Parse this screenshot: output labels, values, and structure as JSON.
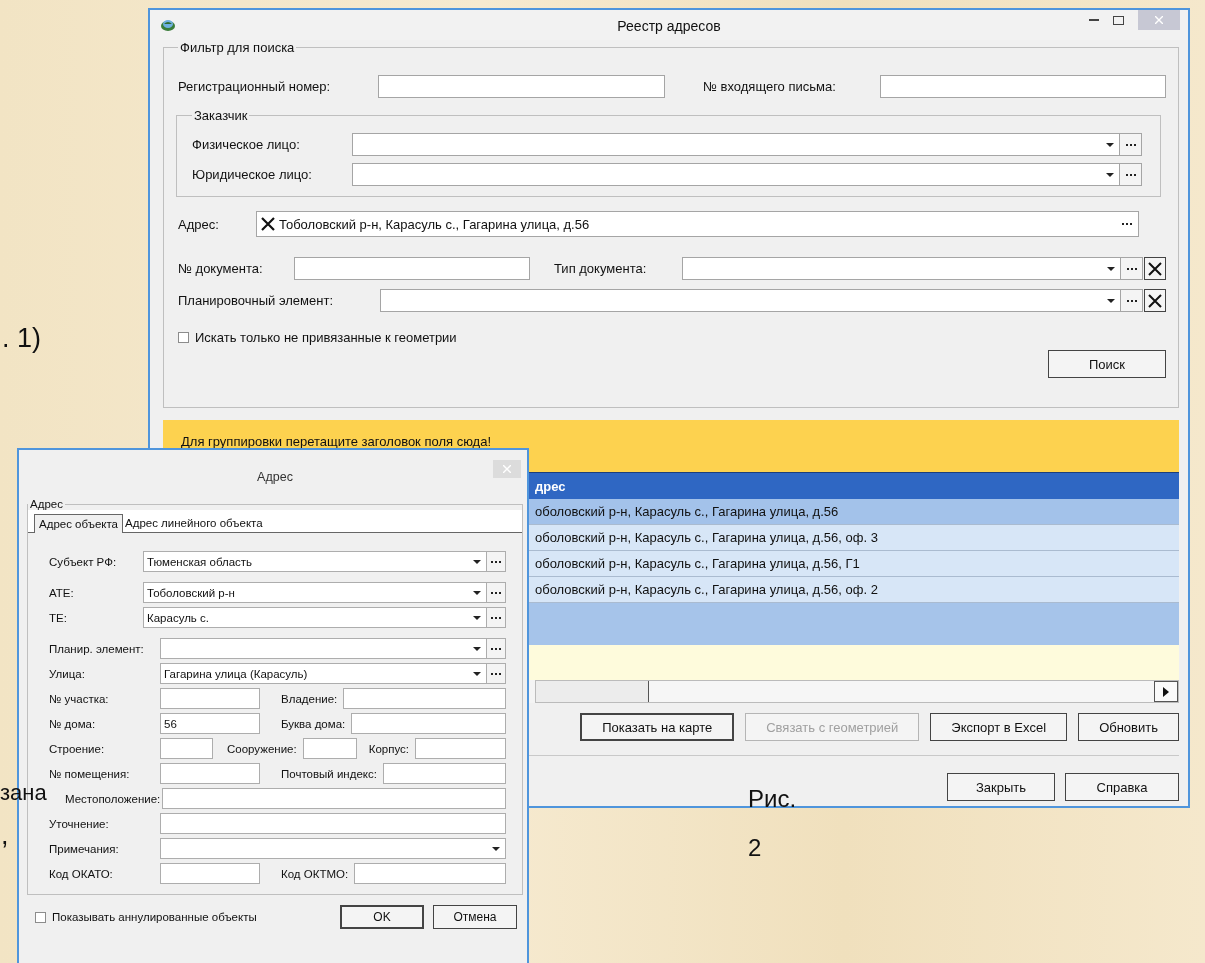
{
  "slide": {
    "texts": [
      {
        "text": ". 1)"
      },
      {
        "text": "зана"
      },
      {
        "text": ","
      },
      {
        "text": "Рис."
      },
      {
        "text": "2"
      }
    ]
  },
  "main_window": {
    "title": "Реестр адресов",
    "filter": {
      "legend": "Фильтр для поиска",
      "reg_number": {
        "label": "Регистрационный номер:"
      },
      "incoming_letter": {
        "label": "№ входящего письма:"
      },
      "customer": {
        "legend": "Заказчик",
        "fields": [
          {
            "label": "Физическое лицо:"
          },
          {
            "label": "Юридическое лицо:"
          }
        ]
      },
      "address": {
        "label": "Адрес:",
        "value": "Тоболовский р-н, Карасуль с., Гагарина улица, д.56"
      },
      "doc_number": {
        "label": "№ документа:"
      },
      "doc_type": {
        "label": "Тип документа:"
      },
      "planning_element": {
        "label": "Планировочный элемент:"
      },
      "unbound_only": {
        "label": "Искать только не привязанные к геометрии",
        "checked": false
      },
      "search_button": "Поиск"
    },
    "grid": {
      "group_hint": "Для группировки перетащите заголовок поля сюда!",
      "columns": [
        "дрес"
      ],
      "rows": [
        {
          "cells": [
            "оболовский р-н, Карасуль с., Гагарина улица, д.56"
          ],
          "selected": true
        },
        {
          "cells": [
            "оболовский р-н, Карасуль с., Гагарина улица, д.56, оф. 3"
          ],
          "selected": false
        },
        {
          "cells": [
            "оболовский р-н, Карасуль с., Гагарина улица, д.56, Г1"
          ],
          "selected": false
        },
        {
          "cells": [
            "оболовский р-н, Карасуль с., Гагарина улица, д.56, оф. 2"
          ],
          "selected": false
        }
      ]
    },
    "buttons": [
      {
        "label": "Показать на карте",
        "disabled": false
      },
      {
        "label": "Связать с геометрией",
        "disabled": true
      },
      {
        "label": "Экспорт в Excel",
        "disabled": false
      },
      {
        "label": "Обновить",
        "disabled": false
      }
    ],
    "footer_buttons": [
      "Закрыть",
      "Справка"
    ]
  },
  "address_dialog": {
    "title": "Адрес",
    "legend": "Адрес",
    "tabs": [
      {
        "label": "Адрес объекта",
        "selected": true
      },
      {
        "label": "Адрес линейного объекта",
        "selected": false
      }
    ],
    "rows": [
      [
        {
          "label": "Субъект РФ:",
          "value": "Тюменская область",
          "kind": "lookup"
        }
      ],
      [
        {
          "label": "АТЕ:",
          "value": "Тоболовский р-н",
          "kind": "lookup"
        }
      ],
      [
        {
          "label": "ТЕ:",
          "value": "Карасуль с.",
          "kind": "lookup"
        }
      ],
      [
        {
          "label": "Планир. элемент:",
          "kind": "lookup"
        }
      ],
      [
        {
          "label": "Улица:",
          "value": "Гагарина улица (Карасуль)",
          "kind": "lookup"
        }
      ],
      [
        {
          "label": "№ участка:",
          "kind": "text"
        },
        {
          "label": "Владение:",
          "kind": "text"
        }
      ],
      [
        {
          "label": "№ дома:",
          "value": "56",
          "kind": "text"
        },
        {
          "label": "Буква дома:",
          "kind": "text"
        }
      ],
      [
        {
          "label": "Строение:",
          "kind": "text"
        },
        {
          "label": "Сооружение:",
          "kind": "text"
        },
        {
          "label": "Корпус:",
          "kind": "text"
        }
      ],
      [
        {
          "label": "№ помещения:",
          "kind": "text"
        },
        {
          "label": "Почтовый индекс:",
          "kind": "text"
        }
      ],
      [
        {
          "label": "Местоположение:",
          "kind": "text"
        }
      ],
      [
        {
          "label": "Уточнение:",
          "kind": "text"
        }
      ],
      [
        {
          "label": "Примечания:",
          "kind": "dropdown"
        }
      ],
      [
        {
          "label": "Код ОКАТО:",
          "kind": "text"
        },
        {
          "label": "Код ОКТМО:",
          "kind": "text"
        }
      ]
    ],
    "show_cancelled": {
      "label": "Показывать аннулированные объекты",
      "checked": false
    },
    "buttons": [
      "OK",
      "Отмена"
    ]
  }
}
